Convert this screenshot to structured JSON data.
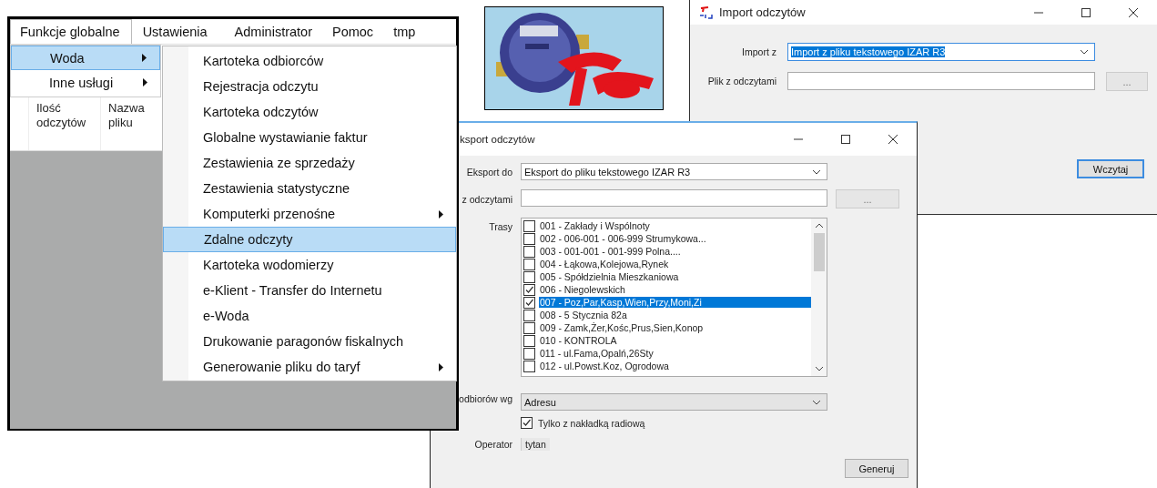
{
  "main_window": {
    "menu_bar": [
      {
        "label": "Funkcje globalne",
        "selected": true
      },
      {
        "label": "Ustawienia",
        "selected": false
      },
      {
        "label": "Administrator",
        "selected": false
      },
      {
        "label": "Pomoc",
        "selected": false
      },
      {
        "label": "tmp",
        "selected": false
      }
    ],
    "submenu": [
      {
        "label": "Woda",
        "selected": true,
        "has_submenu": true
      },
      {
        "label": "Inne usługi",
        "selected": false,
        "has_submenu": true
      }
    ],
    "columns": [
      "Ilość odczytów",
      "Nazwa pliku"
    ],
    "woda_menu": [
      {
        "label": "Kartoteka odbiorców",
        "selected": false,
        "has_submenu": false
      },
      {
        "label": "Rejestracja odczytu",
        "selected": false,
        "has_submenu": false
      },
      {
        "label": "Kartoteka odczytów",
        "selected": false,
        "has_submenu": false
      },
      {
        "label": "Globalne wystawianie faktur",
        "selected": false,
        "has_submenu": false
      },
      {
        "label": "Zestawienia ze sprzedaży",
        "selected": false,
        "has_submenu": false
      },
      {
        "label": "Zestawienia statystyczne",
        "selected": false,
        "has_submenu": false
      },
      {
        "label": "Komputerki przenośne",
        "selected": false,
        "has_submenu": true
      },
      {
        "label": "Zdalne odczyty",
        "selected": true,
        "has_submenu": false
      },
      {
        "label": "Kartoteka wodomierzy",
        "selected": false,
        "has_submenu": false
      },
      {
        "label": "e-Klient - Transfer do Internetu",
        "selected": false,
        "has_submenu": false
      },
      {
        "label": "e-Woda",
        "selected": false,
        "has_submenu": false
      },
      {
        "label": "Drukowanie paragonów fiskalnych",
        "selected": false,
        "has_submenu": false
      },
      {
        "label": "Generowanie pliku do taryf",
        "selected": false,
        "has_submenu": true
      }
    ]
  },
  "import_window": {
    "title": "Import odczytów",
    "import_from": {
      "label": "Import z",
      "value": "Import z pliku tekstowego IZAR R3",
      "text_selected": true
    },
    "file": {
      "label": "Plik z odczytami"
    },
    "browse_button": "...",
    "load_button": "Wczytaj"
  },
  "export_window": {
    "title": "ksport odczytów",
    "export_to": {
      "label": "Eksport do",
      "value": "Eksport  do pliku tekstowego IZAR R3"
    },
    "file": {
      "label": "z odczytami"
    },
    "browse_button": "...",
    "routes_label": "Trasy",
    "routes": [
      {
        "label": "001 - Zakłady i Wspólnoty",
        "checked": false,
        "selected": false
      },
      {
        "label": "002 - 006-001 - 006-999 Strumykowa...",
        "checked": false,
        "selected": false
      },
      {
        "label": "003 - 001-001 - 001-999 Polna....",
        "checked": false,
        "selected": false
      },
      {
        "label": "004 - Łąkowa,Kolejowa,Rynek",
        "checked": false,
        "selected": false
      },
      {
        "label": "005 - Spółdzielnia Mieszkaniowa",
        "checked": false,
        "selected": false
      },
      {
        "label": "006 - Niegolewskich",
        "checked": true,
        "selected": false
      },
      {
        "label": "007 - Poz,Par,Kasp,Wien,Przy,Moni,Zi",
        "checked": true,
        "selected": true
      },
      {
        "label": "008 - 5 Stycznia 82a",
        "checked": false,
        "selected": false
      },
      {
        "label": "009 - Zamk,Żer,Kośc,Prus,Sien,Konop",
        "checked": false,
        "selected": false
      },
      {
        "label": "010 - KONTROLA",
        "checked": false,
        "selected": false
      },
      {
        "label": "011 - ul.Fama,Opalń,26Sty",
        "checked": false,
        "selected": false
      },
      {
        "label": "012 - ul.Powst.Koz, Ogrodowa",
        "checked": false,
        "selected": false
      }
    ],
    "sort": {
      "label": "odbiorów wg",
      "value": "Adresu"
    },
    "radio_only": {
      "label": "Tylko z nakładką radiową",
      "checked": true
    },
    "operator": {
      "label": "Operator",
      "value": "tytan"
    },
    "generate_button": "Generuj"
  }
}
